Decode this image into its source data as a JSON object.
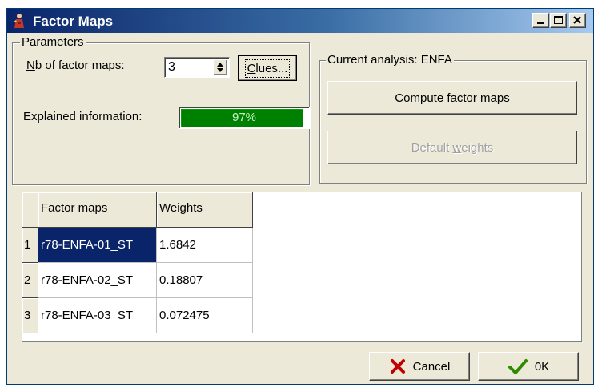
{
  "window": {
    "title": "Factor Maps",
    "icon": "app-figure-icon"
  },
  "parameters": {
    "group_label": "Parameters",
    "nb_label_prefix": "",
    "nb_label_accel": "N",
    "nb_label_rest": "b of factor maps:",
    "nb_value": "3",
    "clues_accel": "C",
    "clues_rest": "lues...",
    "explained_label": "Explained information:",
    "explained_percent": 97,
    "explained_text": "97%"
  },
  "analysis": {
    "group_label": "Current analysis: ENFA",
    "compute_accel": "C",
    "compute_rest": "ompute factor maps",
    "default_pre": "Default ",
    "default_accel": "w",
    "default_rest": "eights"
  },
  "table": {
    "headers": [
      "Factor maps",
      "Weights"
    ],
    "rows": [
      {
        "index": "1",
        "map": "r78-ENFA-01_ST",
        "weight": "1.6842"
      },
      {
        "index": "2",
        "map": "r78-ENFA-02_ST",
        "weight": "0.18807"
      },
      {
        "index": "3",
        "map": "r78-ENFA-03_ST",
        "weight": "0.072475"
      }
    ]
  },
  "footer": {
    "cancel_label": "Cancel",
    "ok_label": "0K"
  },
  "colors": {
    "progress_fill": "#008000",
    "selection": "#0a246a",
    "cancel_icon": "#c00000",
    "ok_icon": "#2e8b00"
  }
}
